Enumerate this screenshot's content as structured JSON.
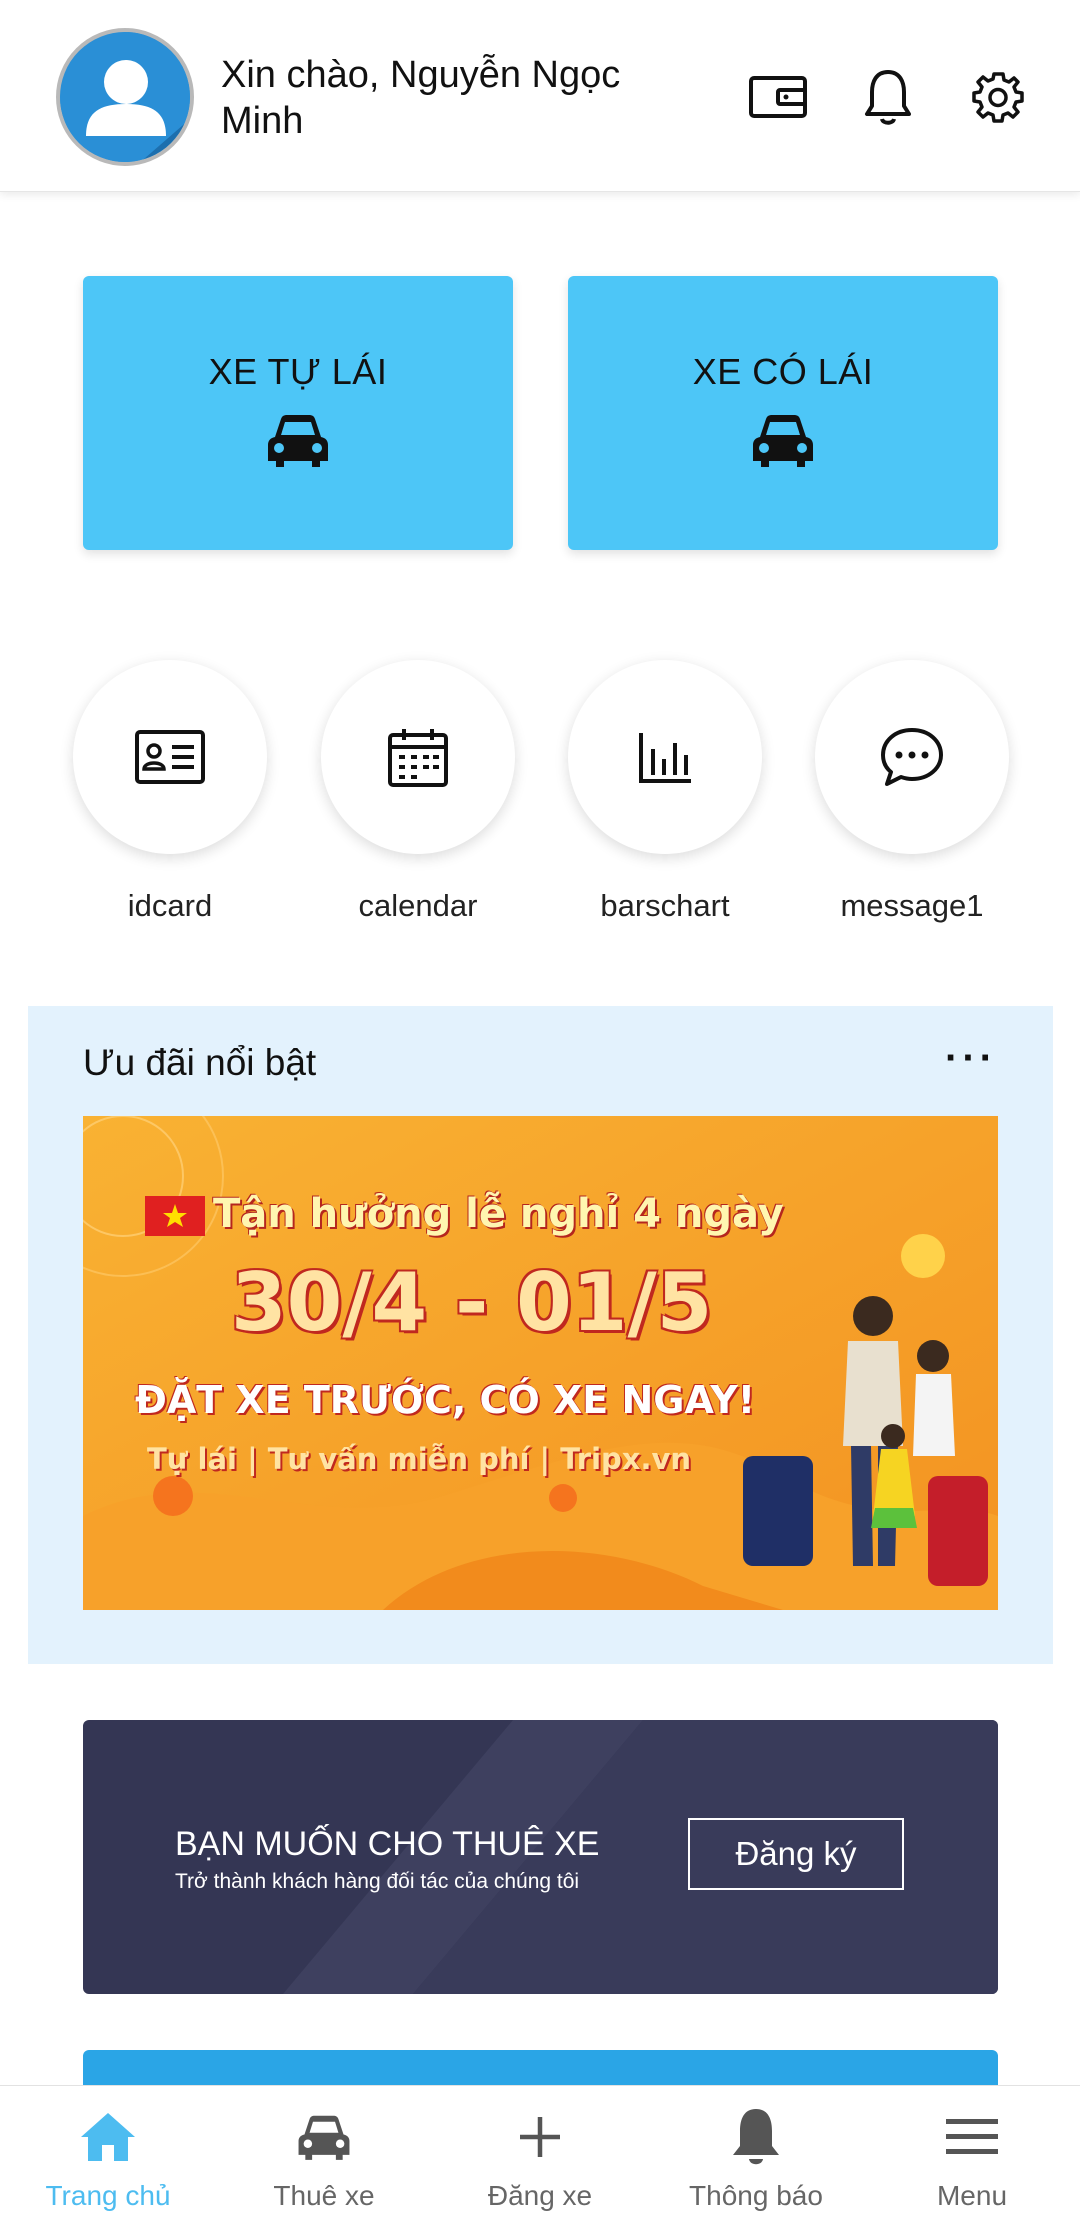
{
  "header": {
    "greeting": "Xin chào, Nguyễn Ngọc Minh"
  },
  "services": [
    {
      "label": "XE TỰ LÁI",
      "icon": "car-icon"
    },
    {
      "label": "XE CÓ LÁI",
      "icon": "car-icon"
    }
  ],
  "quick_actions": [
    {
      "label": "idcard",
      "icon": "idcard-icon"
    },
    {
      "label": "calendar",
      "icon": "calendar-icon"
    },
    {
      "label": "barschart",
      "icon": "barchart-icon"
    },
    {
      "label": "message1",
      "icon": "message-icon"
    }
  ],
  "promo": {
    "title": "Ưu đãi nổi bật",
    "more": "···",
    "banner": {
      "line1": "Tận hưởng lễ nghỉ 4 ngày",
      "line2": "30/4 - 01/5",
      "line3": "ĐẶT XE TRƯỚC, CÓ XE NGAY!",
      "line4": "Tự lái | Tư vấn miễn phí | Tripx.vn"
    }
  },
  "partner": {
    "title": "BẠN MUỐN CHO THUÊ XE",
    "subtitle": "Trở thành khách hàng đối tác của chúng tôi",
    "button": "Đăng ký"
  },
  "bottom_nav": [
    {
      "label": "Trang chủ",
      "icon": "home-icon",
      "active": true
    },
    {
      "label": "Thuê xe",
      "icon": "car-icon",
      "active": false
    },
    {
      "label": "Đăng xe",
      "icon": "plus-icon",
      "active": false
    },
    {
      "label": "Thông báo",
      "icon": "bell-icon",
      "active": false
    },
    {
      "label": "Menu",
      "icon": "menu-icon",
      "active": false
    }
  ],
  "colors": {
    "accent": "#4dc6f7",
    "active_nav": "#4dbcf0",
    "promo_bg": "#e3f2fd",
    "partner_bg": "#343654"
  }
}
